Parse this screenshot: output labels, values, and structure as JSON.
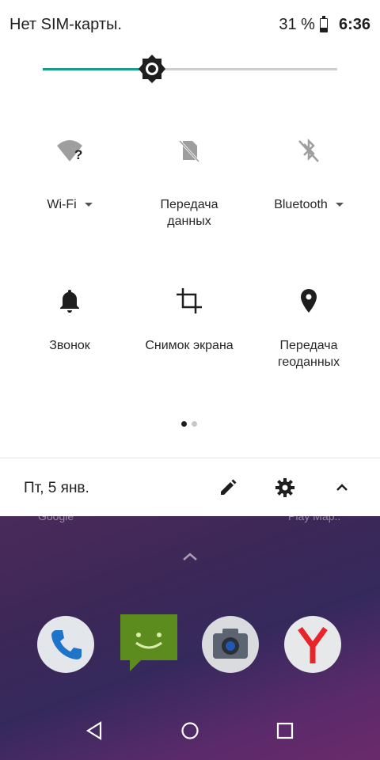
{
  "status_bar": {
    "carrier": "Нет SIM-карты.",
    "battery_percent": "31 %",
    "battery_level": 0.31,
    "time": "6:36"
  },
  "brightness": {
    "level": 0.37
  },
  "quick_settings": {
    "tiles": [
      {
        "id": "wifi",
        "label": "Wi-Fi",
        "icon": "wifi-unknown-icon",
        "has_dropdown": true
      },
      {
        "id": "mobile-data",
        "label": "Передача\nданных",
        "icon": "no-sim-icon",
        "has_dropdown": false
      },
      {
        "id": "bluetooth",
        "label": "Bluetooth",
        "icon": "bluetooth-off-icon",
        "has_dropdown": true
      },
      {
        "id": "ring",
        "label": "Звонок",
        "icon": "bell-icon",
        "has_dropdown": false
      },
      {
        "id": "screenshot",
        "label": "Снимок экрана",
        "icon": "crop-icon",
        "has_dropdown": false
      },
      {
        "id": "location",
        "label": "Передача\nгеоданных",
        "icon": "location-pin-icon",
        "has_dropdown": false
      }
    ],
    "pages": 2,
    "active_page": 0
  },
  "footer": {
    "date": "Пт, 5 янв.",
    "icons": [
      "edit-icon",
      "settings-icon",
      "collapse-icon"
    ]
  },
  "home_screen": {
    "faded_labels": [
      "Google",
      "Play Мар.."
    ],
    "apps": [
      "phone-icon",
      "messages-icon",
      "camera-icon",
      "yandex-icon"
    ]
  },
  "colors": {
    "accent": "#1a9c8b",
    "icon_gray": "#9e9e9e",
    "icon_dark": "#1e1e1e"
  }
}
